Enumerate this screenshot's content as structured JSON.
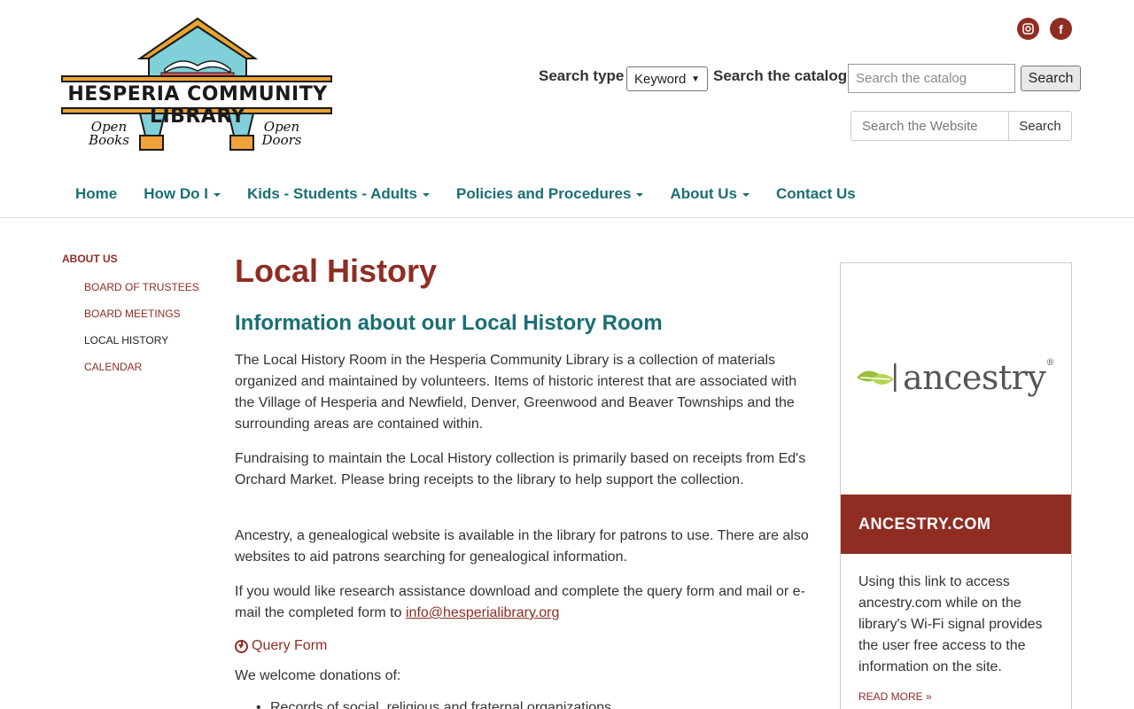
{
  "header": {
    "logo": {
      "title": "HESPERIA COMMUNITY LIBRARY",
      "left_tagline": [
        "Open",
        "Books"
      ],
      "right_tagline": [
        "Open",
        "Doors"
      ]
    },
    "social": [
      {
        "icon": "instagram-icon",
        "glyph": "◙"
      },
      {
        "icon": "facebook-icon",
        "glyph": "f"
      }
    ],
    "catalog_search": {
      "type_label": "Search type",
      "type_value": "Keyword",
      "label": "Search the catalog",
      "placeholder": "Search the catalog",
      "button": "Search"
    },
    "site_search": {
      "placeholder": "Search the Website",
      "button": "Search"
    }
  },
  "nav": [
    {
      "label": "Home",
      "dropdown": false
    },
    {
      "label": "How Do I",
      "dropdown": true
    },
    {
      "label": "Kids - Students - Adults",
      "dropdown": true
    },
    {
      "label": "Policies and Procedures",
      "dropdown": true
    },
    {
      "label": "About Us",
      "dropdown": true
    },
    {
      "label": "Contact Us",
      "dropdown": false
    }
  ],
  "sidebar": {
    "heading": "ABOUT US",
    "items": [
      {
        "label": "BOARD OF TRUSTEES",
        "active": false
      },
      {
        "label": "BOARD MEETINGS",
        "active": false
      },
      {
        "label": "LOCAL HISTORY",
        "active": true
      },
      {
        "label": "CALENDAR",
        "active": false
      }
    ]
  },
  "main": {
    "title": "Local History",
    "section_title": "Information about our Local History Room",
    "paragraphs": [
      "The Local History Room in the Hesperia Community Library is a collection of materials organized and maintained by volunteers. Items of historic interest that are associated with the Village of Hesperia and Newfield, Denver, Greenwood and Beaver Townships and the surrounding areas are contained within.",
      "Fundraising to maintain the Local History collection is primarily based on receipts from Ed's Orchard Market. Please bring receipts to the library to help support the collection.",
      "Ancestry, a genealogical website is available in the library for patrons to use. There are also websites to aid patrons searching for genealogical information.",
      "If you would like research assistance download and complete the query form and mail or e-mail the completed form to"
    ],
    "email": "info@hesperialibrary.org",
    "query_form": "Query Form",
    "donations_intro": "We welcome donations of:",
    "donations_first": "Records of social, religious and fraternal organizations"
  },
  "ancestry_card": {
    "logo_word": "ancestry",
    "heading": "ANCESTRY.COM",
    "text": "Using this link to access ancestry.com while on the library's Wi-Fi signal provides the user free access to the information on the site.",
    "read_more": "READ MORE »"
  },
  "colors": {
    "brand_red": "#8f2d23",
    "brand_teal": "#1a6f73",
    "ancestry_green": "#9bbf3b"
  }
}
